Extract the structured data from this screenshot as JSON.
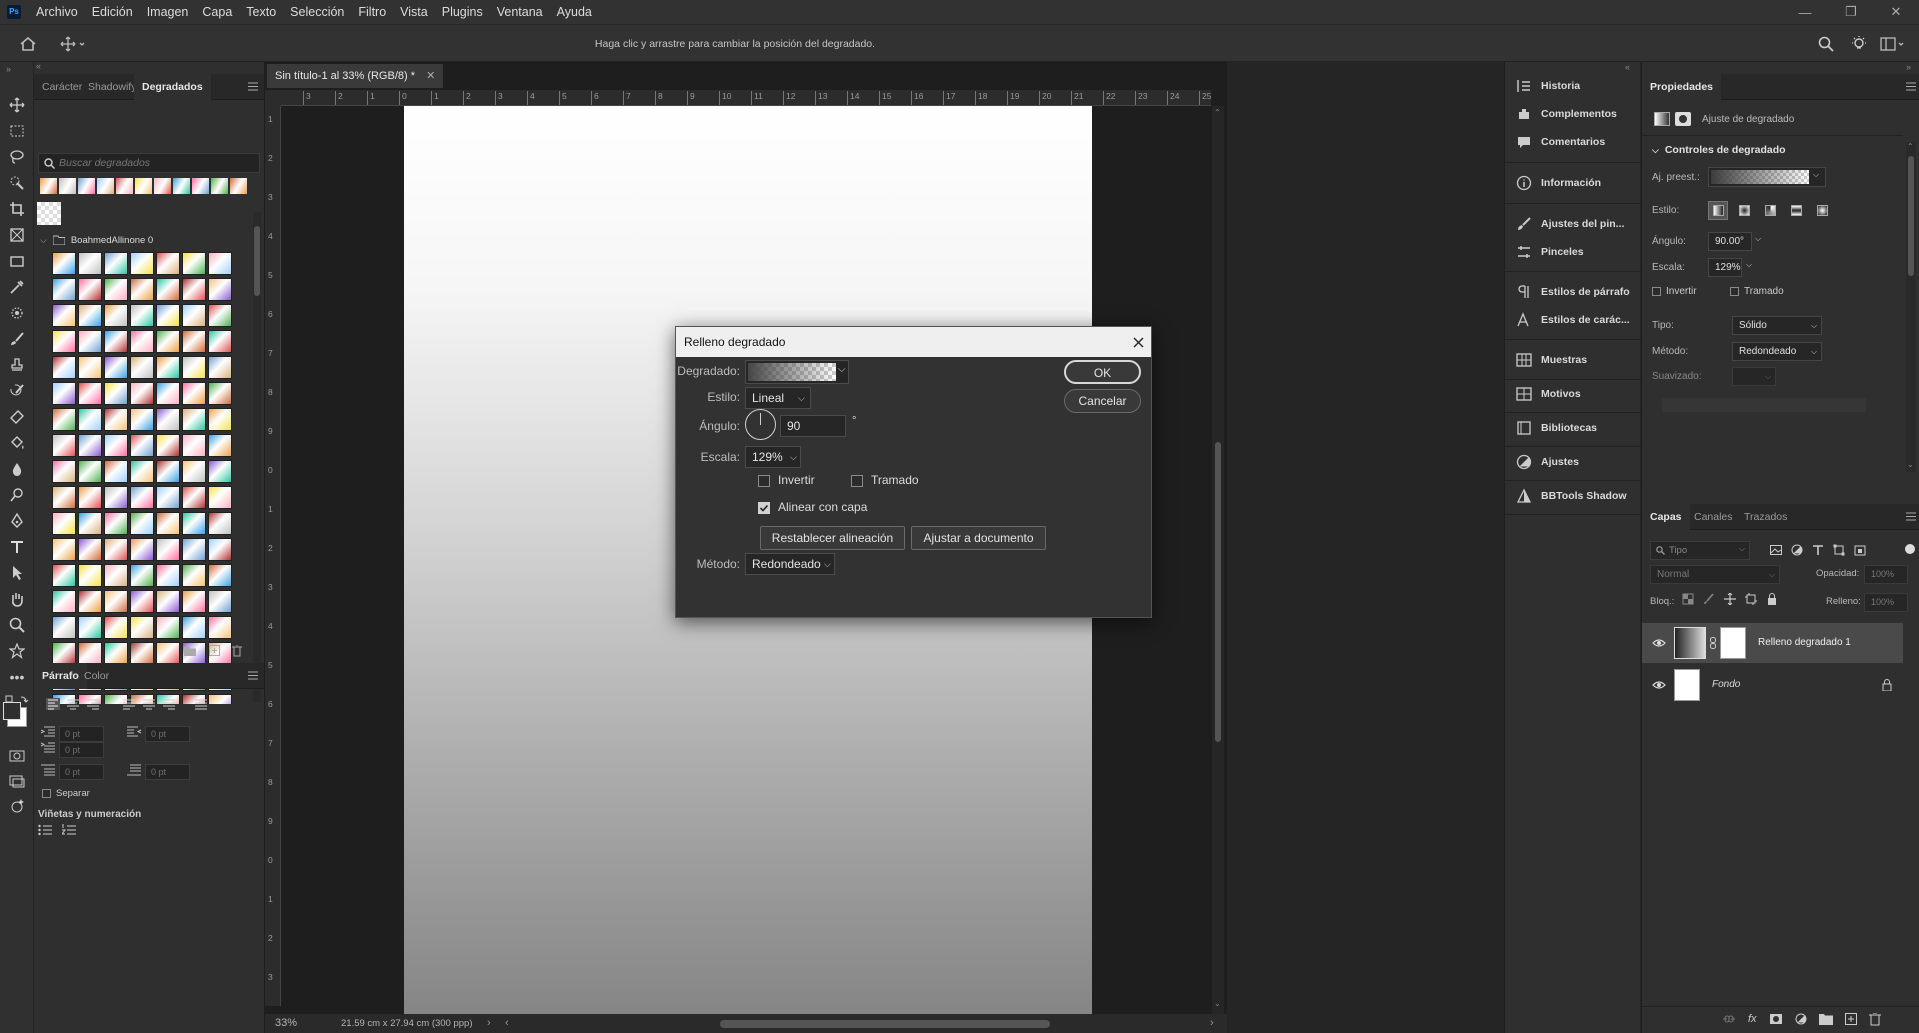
{
  "menubar": {
    "logo": "Ps",
    "items": [
      "Archivo",
      "Edición",
      "Imagen",
      "Capa",
      "Texto",
      "Selección",
      "Filtro",
      "Vista",
      "Plugins",
      "Ventana",
      "Ayuda"
    ]
  },
  "optionsbar": {
    "hint": "Haga clic y arrastre para cambiar la posición del degradado."
  },
  "left_panel": {
    "tabs": [
      "Carácter",
      "Shadowify",
      "Degradados"
    ],
    "active_tab": "Degradados",
    "search_placeholder": "Buscar degradados",
    "folder_name": "BoahmedAllinone 0",
    "para_tabs": [
      "Párrafo",
      "Color"
    ],
    "indent_values": [
      "0 pt",
      "0 pt",
      "0 pt",
      "0 pt",
      "0 pt"
    ],
    "separar_label": "Separar",
    "vinetas_label": "Viñetas y numeración"
  },
  "document": {
    "tab_title": "Sin título-1 al 33% (RGB/8) *",
    "ruler_h": [
      "3",
      "2",
      "1",
      "0",
      "1",
      "2",
      "3",
      "4",
      "5",
      "6",
      "7",
      "8",
      "9",
      "10",
      "11",
      "12",
      "13",
      "14",
      "15",
      "16",
      "17",
      "18",
      "19",
      "20",
      "21",
      "22",
      "23",
      "24",
      "25"
    ],
    "ruler_v": [
      "1",
      "2",
      "3",
      "4",
      "5",
      "6",
      "7",
      "8",
      "9",
      "0",
      "1",
      "2",
      "3",
      "4",
      "5",
      "6",
      "7",
      "8",
      "9",
      "0",
      "1",
      "2",
      "3"
    ],
    "zoom": "33%",
    "doc_size": "21.59 cm x 27.94 cm (300 ppp)"
  },
  "dialog": {
    "title": "Relleno degradado",
    "degradado_label": "Degradado:",
    "estilo_label": "Estilo:",
    "estilo_value": "Lineal",
    "angulo_label": "Ángulo:",
    "angulo_value": "90",
    "degree_symbol": "°",
    "escala_label": "Escala:",
    "escala_value": "129%",
    "invertir_label": "Invertir",
    "tramado_label": "Tramado",
    "alinear_label": "Alinear con capa",
    "restablecer_label": "Restablecer alineación",
    "ajustar_label": "Ajustar a documento",
    "metodo_label": "Método:",
    "metodo_value": "Redondeado",
    "ok_label": "OK",
    "cancel_label": "Cancelar",
    "invertir_checked": false,
    "tramado_checked": false,
    "alinear_checked": true
  },
  "mid_panel": {
    "items": [
      "Historia",
      "Complementos",
      "Comentarios",
      "Información",
      "Ajustes del pin...",
      "Pinceles",
      "Estilos de párrafo",
      "Estilos de carác...",
      "Muestras",
      "Motivos",
      "Bibliotecas",
      "Ajustes",
      "BBTools Shadow"
    ]
  },
  "properties": {
    "tab": "Propiedades",
    "subtitle": "Ajuste de degradado",
    "section": "Controles de degradado",
    "preset_label": "Aj. preest.:",
    "estilo_label": "Estilo:",
    "angulo_label": "Ángulo:",
    "angulo_value": "90.00°",
    "escala_label": "Escala:",
    "escala_value": "129%",
    "invertir_label": "Invertir",
    "tramado_label": "Tramado",
    "tipo_label": "Tipo:",
    "tipo_value": "Sólido",
    "metodo_label": "Método:",
    "metodo_value": "Redondeado",
    "suavizado_label": "Suavizado:"
  },
  "layers": {
    "tabs": [
      "Capas",
      "Canales",
      "Trazados"
    ],
    "filter_placeholder": "Tipo",
    "blend_mode": "Normal",
    "opacity_label": "Opacidad:",
    "opacity_value": "100%",
    "lock_label": "Bloq.:",
    "fill_label": "Relleno:",
    "fill_value": "100%",
    "items": [
      "Relleno degradado 1",
      "Fondo"
    ]
  },
  "colors": {
    "accent": "#31a8ff",
    "dialog_bg": "#323232",
    "panel_bg": "#2f2f2f"
  }
}
